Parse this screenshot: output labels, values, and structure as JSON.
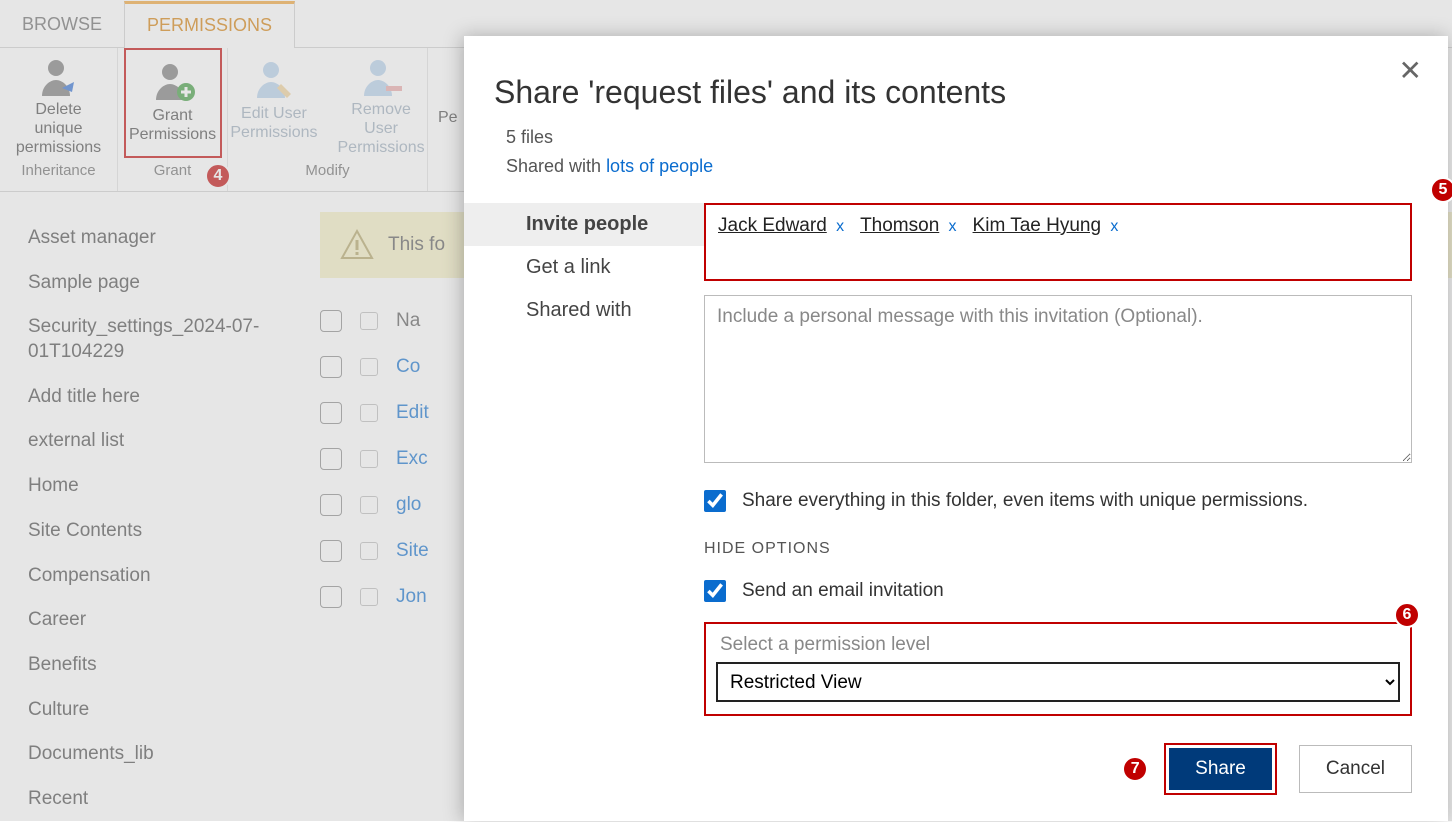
{
  "tabs": {
    "browse": "BROWSE",
    "permissions": "PERMISSIONS"
  },
  "ribbon": {
    "delete": "Delete unique permissions",
    "grant": "Grant Permissions",
    "edit": "Edit User Permissions",
    "remove": "Remove User Permissions",
    "pe": "Pe",
    "group_inherit": "Inheritance",
    "group_grant": "Grant",
    "group_modify": "Modify"
  },
  "badges": {
    "b4": "4",
    "b5": "5",
    "b6": "6",
    "b7": "7"
  },
  "nav": {
    "items": [
      "Asset manager",
      "Sample page",
      "Security_settings_2024-07-01T104229",
      "Add title here",
      "external list",
      "Home",
      "Site Contents",
      "Compensation",
      "Career",
      "Benefits",
      "Culture",
      "Documents_lib",
      "Recent"
    ]
  },
  "warning": "This fo",
  "list": {
    "header": "Na",
    "rows": [
      "Co",
      "Edit",
      "Exc",
      "glo",
      "Site",
      "Jon"
    ]
  },
  "dialog": {
    "title": "Share 'request files' and its contents",
    "file_count": "5 files",
    "shared_pre": "Shared with ",
    "shared_link": "lots of people",
    "tabs": {
      "invite": "Invite people",
      "link": "Get a link",
      "shared": "Shared with"
    },
    "chips": [
      {
        "name": "Jack Edward"
      },
      {
        "name": "Thomson"
      },
      {
        "name": "Kim Tae Hyung"
      }
    ],
    "msg_placeholder": "Include a personal message with this invitation (Optional).",
    "share_everything": "Share everything in this folder, even items with unique permissions.",
    "hide_options": "HIDE OPTIONS",
    "send_email": "Send an email invitation",
    "perm_label": "Select a permission level",
    "perm_value": "Restricted View",
    "share_btn": "Share",
    "cancel_btn": "Cancel",
    "close": "✕",
    "chip_x": "x"
  }
}
